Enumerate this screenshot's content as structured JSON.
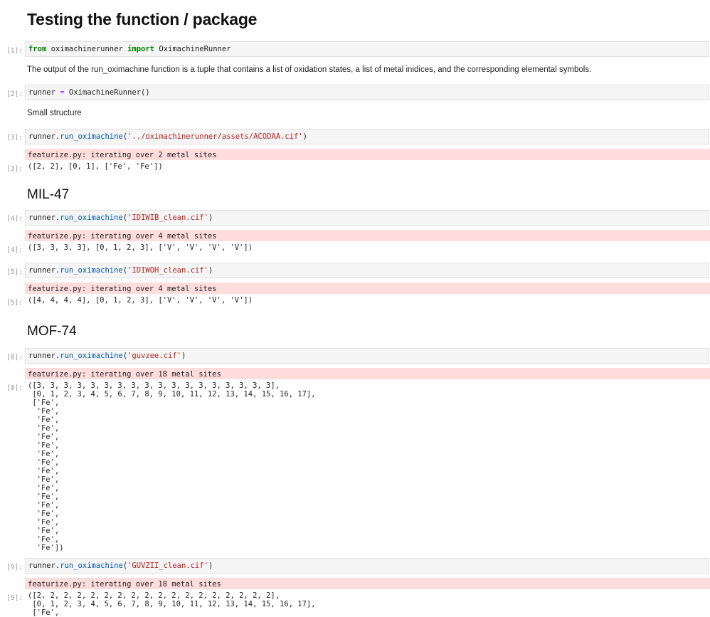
{
  "headings": {
    "main": "Testing the function / package",
    "mil47": "MIL-47",
    "mof74": "MOF-74"
  },
  "markdown": {
    "description": "The output of the run_oximachine function is a tuple that contains a list of oxidation states, a list of metal inidices, and the corresponding elemental symbols.",
    "small_structure": "Small structure"
  },
  "cells": {
    "c1": {
      "prompt": "[1]:",
      "code": {
        "kw_from": "from",
        "module": " oximachinerunner ",
        "kw_import": "import",
        "name": " OximachineRunner"
      }
    },
    "c2": {
      "prompt": "[2]:",
      "code": {
        "var": "runner ",
        "op": "=",
        "call": " OximachineRunner()"
      }
    },
    "c3": {
      "prompt": "[3]:",
      "code": {
        "obj": "runner.",
        "method": "run_oximachine",
        "open": "(",
        "arg": "'../oximachinerunner/assets/ACODAA.cif'",
        "close": ")"
      },
      "stderr": "featurize.py: iterating over 2 metal sites",
      "out_prompt": "[3]:",
      "output": "([2, 2], [0, 1], ['Fe', 'Fe'])"
    },
    "c4": {
      "prompt": "[4]:",
      "code": {
        "obj": "runner.",
        "method": "run_oximachine",
        "open": "(",
        "arg": "'IDIWIB_clean.cif'",
        "close": ")"
      },
      "stderr": "featurize.py: iterating over 4 metal sites",
      "out_prompt": "[4]:",
      "output": "([3, 3, 3, 3], [0, 1, 2, 3], ['V', 'V', 'V', 'V'])"
    },
    "c5": {
      "prompt": "[5]:",
      "code": {
        "obj": "runner.",
        "method": "run_oximachine",
        "open": "(",
        "arg": "'IDIWOH_clean.cif'",
        "close": ")"
      },
      "stderr": "featurize.py: iterating over 4 metal sites",
      "out_prompt": "[5]:",
      "output": "([4, 4, 4, 4], [0, 1, 2, 3], ['V', 'V', 'V', 'V'])"
    },
    "c8": {
      "prompt": "[8]:",
      "code": {
        "obj": "runner.",
        "method": "run_oximachine",
        "open": "(",
        "arg": "'guvzee.cif'",
        "close": ")"
      },
      "stderr": "featurize.py: iterating over 18 metal sites",
      "out_prompt": "[8]:",
      "output": "([3, 3, 3, 3, 3, 3, 3, 3, 3, 3, 3, 3, 3, 3, 3, 3, 3, 3],\n [0, 1, 2, 3, 4, 5, 6, 7, 8, 9, 10, 11, 12, 13, 14, 15, 16, 17],\n ['Fe',\n  'Fe',\n  'Fe',\n  'Fe',\n  'Fe',\n  'Fe',\n  'Fe',\n  'Fe',\n  'Fe',\n  'Fe',\n  'Fe',\n  'Fe',\n  'Fe',\n  'Fe',\n  'Fe',\n  'Fe',\n  'Fe',\n  'Fe'])"
    },
    "c9": {
      "prompt": "[9]:",
      "code": {
        "obj": "runner.",
        "method": "run_oximachine",
        "open": "(",
        "arg": "'GUVZII_clean.cif'",
        "close": ")"
      },
      "stderr": "featurize.py: iterating over 18 metal sites",
      "out_prompt": "[9]:",
      "output": "([2, 2, 2, 2, 2, 2, 2, 2, 2, 2, 2, 2, 2, 2, 2, 2, 2, 2],\n [0, 1, 2, 3, 4, 5, 6, 7, 8, 9, 10, 11, 12, 13, 14, 15, 16, 17],\n ['Fe',"
    }
  }
}
